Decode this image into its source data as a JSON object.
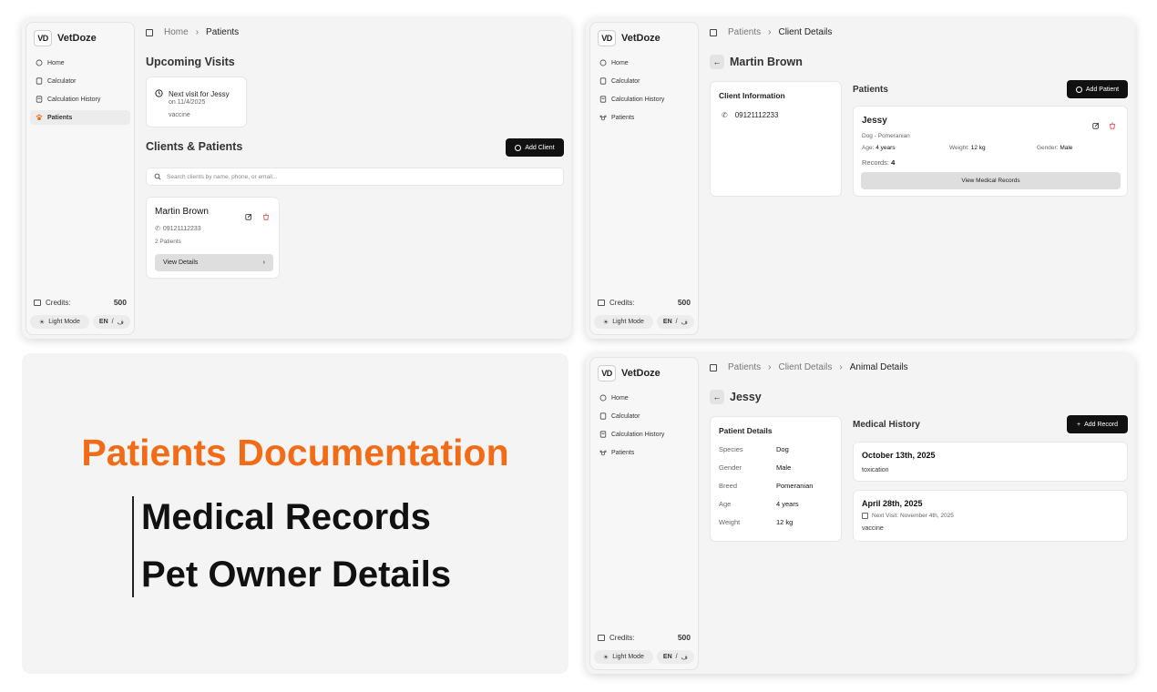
{
  "brand": {
    "logo": "VD",
    "name": "VetDoze"
  },
  "nav": [
    "Home",
    "Calculator",
    "Calculation History",
    "Patients"
  ],
  "credits": {
    "label": "Credits:",
    "value": "500"
  },
  "theme_toggle": "Light Mode",
  "language": "EN",
  "lang_sep": "/",
  "screen1": {
    "breadcrumb": [
      "Home",
      "Patients"
    ],
    "upcoming_title": "Upcoming Visits",
    "visit": {
      "title": "Next visit for Jessy",
      "date": "on 11/4/2025",
      "type": "vaccine"
    },
    "clients_title": "Clients & Patients",
    "add_client": "Add Client",
    "search_placeholder": "Search clients by name, phone, or email...",
    "client": {
      "name": "Martin Brown",
      "phone": "09121112233",
      "patients": "2 Patients",
      "view": "View Details"
    }
  },
  "screen2": {
    "breadcrumb": [
      "Patients",
      "Client Details"
    ],
    "title": "Martin Brown",
    "client_info_title": "Client Information",
    "phone": "09121112233",
    "patients_title": "Patients",
    "add_patient": "Add Patient",
    "patient": {
      "name": "Jessy",
      "breed": "Dog - Pomeranian",
      "age_label": "Age:",
      "age": "4 years",
      "weight_label": "Weight:",
      "weight": "12 kg",
      "gender_label": "Gender:",
      "gender": "Male",
      "records_label": "Records:",
      "records": "4",
      "view": "View Medical Records"
    }
  },
  "screen3": {
    "breadcrumb": [
      "Patients",
      "Client Details",
      "Animal Details"
    ],
    "title": "Jessy",
    "details_title": "Patient Details",
    "details": [
      {
        "label": "Species",
        "value": "Dog"
      },
      {
        "label": "Gender",
        "value": "Male"
      },
      {
        "label": "Breed",
        "value": "Pomeranian"
      },
      {
        "label": "Age",
        "value": "4 years"
      },
      {
        "label": "Weight",
        "value": "12 kg"
      }
    ],
    "history_title": "Medical History",
    "add_record": "Add Record",
    "records": [
      {
        "date": "October 13th, 2025",
        "note": "toxication"
      },
      {
        "date": "April 28th, 2025",
        "next": "Next Visit: November 4th, 2025",
        "note": "vaccine"
      }
    ]
  },
  "promo": {
    "title": "Patients Documentation",
    "line1": "Medical Records",
    "line2": "Pet Owner Details",
    "accent": "#f26b16"
  }
}
